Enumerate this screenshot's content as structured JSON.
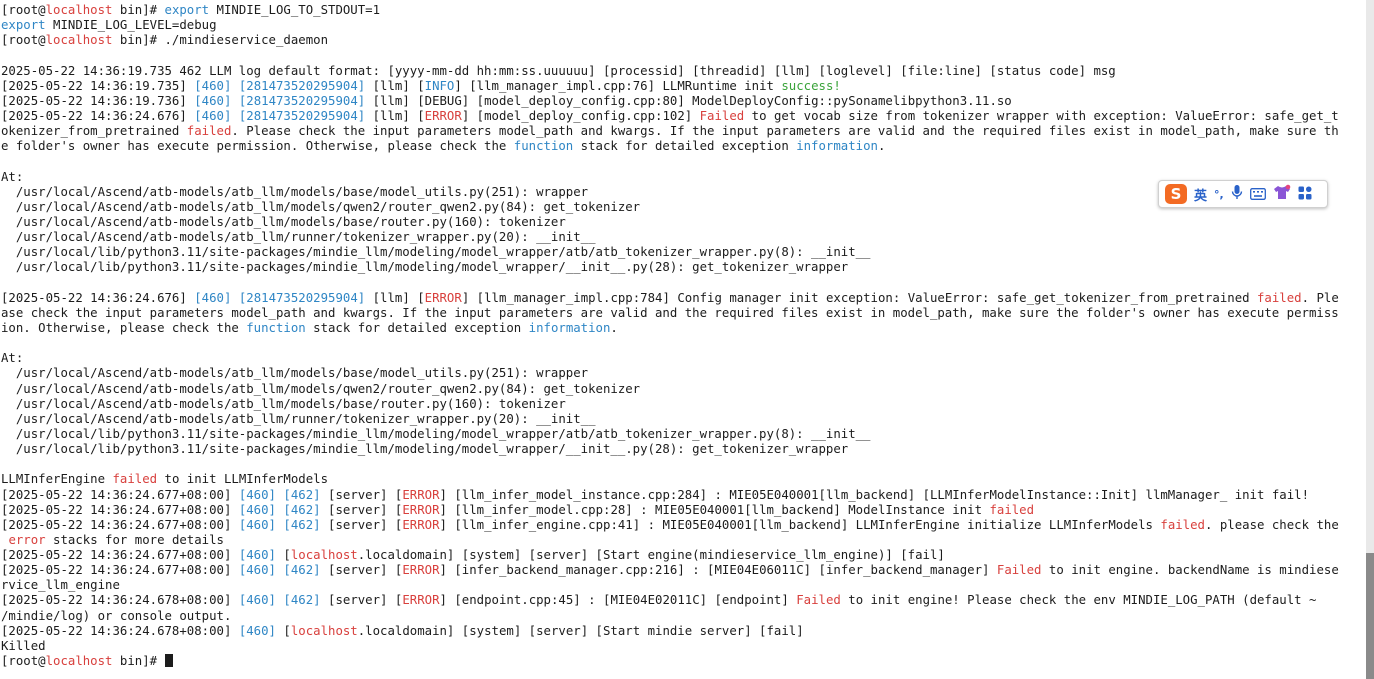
{
  "terminal": {
    "lines": [
      [
        {
          "t": "[root@"
        },
        {
          "t": "localhost",
          "c": "red"
        },
        {
          "t": " bin]# "
        },
        {
          "t": "export",
          "c": "blue"
        },
        {
          "t": " MINDIE_LOG_TO_STDOUT=1"
        }
      ],
      [
        {
          "t": "export",
          "c": "blue"
        },
        {
          "t": " MINDIE_LOG_LEVEL=debug"
        }
      ],
      [
        {
          "t": "[root@"
        },
        {
          "t": "localhost",
          "c": "red"
        },
        {
          "t": " bin]# ./mindieservice_daemon"
        }
      ],
      [],
      [
        {
          "t": "2025-05-22 14:36:19.735 462 LLM log default format: [yyyy-mm-dd hh:mm:ss.uuuuuu] [processid] [threadid] [llm] [loglevel] [file:line] [status code] msg"
        }
      ],
      [
        {
          "t": "[2025-05-22 14:36:19.735] "
        },
        {
          "t": "[460]",
          "c": "blue"
        },
        {
          "t": " "
        },
        {
          "t": "[281473520295904]",
          "c": "blue"
        },
        {
          "t": " [llm] ["
        },
        {
          "t": "INFO",
          "c": "blue"
        },
        {
          "t": "] [llm_manager_impl.cpp:76] LLMRuntime init "
        },
        {
          "t": "success!",
          "c": "green"
        }
      ],
      [
        {
          "t": "[2025-05-22 14:36:19.736] "
        },
        {
          "t": "[460]",
          "c": "blue"
        },
        {
          "t": " "
        },
        {
          "t": "[281473520295904]",
          "c": "blue"
        },
        {
          "t": " [llm] [DEBUG] [model_deploy_config.cpp:80] ModelDeployConfig::pySonamelibpython3.11.so"
        }
      ],
      [
        {
          "t": "[2025-05-22 14:36:24.676] "
        },
        {
          "t": "[460]",
          "c": "blue"
        },
        {
          "t": " "
        },
        {
          "t": "[281473520295904]",
          "c": "blue"
        },
        {
          "t": " [llm] ["
        },
        {
          "t": "ERROR",
          "c": "red"
        },
        {
          "t": "] [model_deploy_config.cpp:102] "
        },
        {
          "t": "Failed",
          "c": "red"
        },
        {
          "t": " to get vocab size from tokenizer wrapper with exception: ValueError: safe_get_t"
        }
      ],
      [
        {
          "t": "okenizer_from_pretrained "
        },
        {
          "t": "failed",
          "c": "red"
        },
        {
          "t": ". Please check the input parameters model_path and kwargs. If the input parameters are valid and the required files exist in model_path, make sure th"
        }
      ],
      [
        {
          "t": "e folder's owner has execute permission. Otherwise, please check the "
        },
        {
          "t": "function",
          "c": "blue"
        },
        {
          "t": " stack for detailed exception "
        },
        {
          "t": "information",
          "c": "blue"
        },
        {
          "t": "."
        }
      ],
      [],
      [
        {
          "t": "At:"
        }
      ],
      [
        {
          "t": "  /usr/local/Ascend/atb-models/atb_llm/models/base/model_utils.py(251): wrapper"
        }
      ],
      [
        {
          "t": "  /usr/local/Ascend/atb-models/atb_llm/models/qwen2/router_qwen2.py(84): get_tokenizer"
        }
      ],
      [
        {
          "t": "  /usr/local/Ascend/atb-models/atb_llm/models/base/router.py(160): tokenizer"
        }
      ],
      [
        {
          "t": "  /usr/local/Ascend/atb-models/atb_llm/runner/tokenizer_wrapper.py(20): __init__"
        }
      ],
      [
        {
          "t": "  /usr/local/lib/python3.11/site-packages/mindie_llm/modeling/model_wrapper/atb/atb_tokenizer_wrapper.py(8): __init__"
        }
      ],
      [
        {
          "t": "  /usr/local/lib/python3.11/site-packages/mindie_llm/modeling/model_wrapper/__init__.py(28): get_tokenizer_wrapper"
        }
      ],
      [],
      [
        {
          "t": "[2025-05-22 14:36:24.676] "
        },
        {
          "t": "[460]",
          "c": "blue"
        },
        {
          "t": " "
        },
        {
          "t": "[281473520295904]",
          "c": "blue"
        },
        {
          "t": " [llm] ["
        },
        {
          "t": "ERROR",
          "c": "red"
        },
        {
          "t": "] [llm_manager_impl.cpp:784] Config manager init exception: ValueError: safe_get_tokenizer_from_pretrained "
        },
        {
          "t": "failed",
          "c": "red"
        },
        {
          "t": ". Ple"
        }
      ],
      [
        {
          "t": "ase check the input parameters model_path and kwargs. If the input parameters are valid and the required files exist in model_path, make sure the folder's owner has execute permiss"
        }
      ],
      [
        {
          "t": "ion. Otherwise, please check the "
        },
        {
          "t": "function",
          "c": "blue"
        },
        {
          "t": " stack for detailed exception "
        },
        {
          "t": "information",
          "c": "blue"
        },
        {
          "t": "."
        }
      ],
      [],
      [
        {
          "t": "At:"
        }
      ],
      [
        {
          "t": "  /usr/local/Ascend/atb-models/atb_llm/models/base/model_utils.py(251): wrapper"
        }
      ],
      [
        {
          "t": "  /usr/local/Ascend/atb-models/atb_llm/models/qwen2/router_qwen2.py(84): get_tokenizer"
        }
      ],
      [
        {
          "t": "  /usr/local/Ascend/atb-models/atb_llm/models/base/router.py(160): tokenizer"
        }
      ],
      [
        {
          "t": "  /usr/local/Ascend/atb-models/atb_llm/runner/tokenizer_wrapper.py(20): __init__"
        }
      ],
      [
        {
          "t": "  /usr/local/lib/python3.11/site-packages/mindie_llm/modeling/model_wrapper/atb/atb_tokenizer_wrapper.py(8): __init__"
        }
      ],
      [
        {
          "t": "  /usr/local/lib/python3.11/site-packages/mindie_llm/modeling/model_wrapper/__init__.py(28): get_tokenizer_wrapper"
        }
      ],
      [],
      [
        {
          "t": "LLMInferEngine "
        },
        {
          "t": "failed",
          "c": "red"
        },
        {
          "t": " to init LLMInferModels"
        }
      ],
      [
        {
          "t": "[2025-05-22 14:36:24.677+08:00] "
        },
        {
          "t": "[460]",
          "c": "blue"
        },
        {
          "t": " "
        },
        {
          "t": "[462]",
          "c": "blue"
        },
        {
          "t": " [server] ["
        },
        {
          "t": "ERROR",
          "c": "red"
        },
        {
          "t": "] [llm_infer_model_instance.cpp:284] : MIE05E040001[llm_backend] [LLMInferModelInstance::Init] llmManager_ init fail!"
        }
      ],
      [
        {
          "t": "[2025-05-22 14:36:24.677+08:00] "
        },
        {
          "t": "[460]",
          "c": "blue"
        },
        {
          "t": " "
        },
        {
          "t": "[462]",
          "c": "blue"
        },
        {
          "t": " [server] ["
        },
        {
          "t": "ERROR",
          "c": "red"
        },
        {
          "t": "] [llm_infer_model.cpp:28] : MIE05E040001[llm_backend] ModelInstance init "
        },
        {
          "t": "failed",
          "c": "red"
        }
      ],
      [
        {
          "t": "[2025-05-22 14:36:24.677+08:00] "
        },
        {
          "t": "[460]",
          "c": "blue"
        },
        {
          "t": " "
        },
        {
          "t": "[462]",
          "c": "blue"
        },
        {
          "t": " [server] ["
        },
        {
          "t": "ERROR",
          "c": "red"
        },
        {
          "t": "] [llm_infer_engine.cpp:41] : MIE05E040001[llm_backend] LLMInferEngine initialize LLMInferModels "
        },
        {
          "t": "failed",
          "c": "red"
        },
        {
          "t": ". please check the"
        }
      ],
      [
        {
          "t": " "
        },
        {
          "t": "error",
          "c": "red"
        },
        {
          "t": " stacks for more details"
        }
      ],
      [
        {
          "t": "[2025-05-22 14:36:24.677+08:00] "
        },
        {
          "t": "[460]",
          "c": "blue"
        },
        {
          "t": " ["
        },
        {
          "t": "localhost",
          "c": "red"
        },
        {
          "t": ".localdomain] [system] [server] [Start engine(mindieservice_llm_engine)] [fail]"
        }
      ],
      [
        {
          "t": "[2025-05-22 14:36:24.677+08:00] "
        },
        {
          "t": "[460]",
          "c": "blue"
        },
        {
          "t": " "
        },
        {
          "t": "[462]",
          "c": "blue"
        },
        {
          "t": " [server] ["
        },
        {
          "t": "ERROR",
          "c": "red"
        },
        {
          "t": "] [infer_backend_manager.cpp:216] : [MIE04E06011C] [infer_backend_manager] "
        },
        {
          "t": "Failed",
          "c": "red"
        },
        {
          "t": " to init engine. backendName is mindiese"
        }
      ],
      [
        {
          "t": "rvice_llm_engine"
        }
      ],
      [
        {
          "t": "[2025-05-22 14:36:24.678+08:00] "
        },
        {
          "t": "[460]",
          "c": "blue"
        },
        {
          "t": " "
        },
        {
          "t": "[462]",
          "c": "blue"
        },
        {
          "t": " [server] ["
        },
        {
          "t": "ERROR",
          "c": "red"
        },
        {
          "t": "] [endpoint.cpp:45] : [MIE04E02011C] [endpoint] "
        },
        {
          "t": "Failed",
          "c": "red"
        },
        {
          "t": " to init engine! Please check the env MINDIE_LOG_PATH (default ~"
        }
      ],
      [
        {
          "t": "/mindie/log) or console output."
        }
      ],
      [
        {
          "t": "[2025-05-22 14:36:24.678+08:00] "
        },
        {
          "t": "[460]",
          "c": "blue"
        },
        {
          "t": " ["
        },
        {
          "t": "localhost",
          "c": "red"
        },
        {
          "t": ".localdomain] [system] [server] [Start mindie server] [fail]"
        }
      ],
      [
        {
          "t": "Killed"
        }
      ],
      [
        {
          "t": "[root@"
        },
        {
          "t": "localhost",
          "c": "red"
        },
        {
          "t": " bin]# "
        },
        {
          "t": "cursor",
          "c": "cursor"
        }
      ]
    ]
  },
  "ime_toolbar": {
    "logo": "S",
    "lang_label": "英",
    "punct_label": "°,",
    "icons": [
      "microphone-icon",
      "keyboard-icon",
      "shirt-icon",
      "grid-icon"
    ]
  },
  "colors": {
    "blue": "#2f86c5",
    "red": "#d8403d",
    "green": "#3aa33a",
    "text": "#1c1c1c"
  }
}
